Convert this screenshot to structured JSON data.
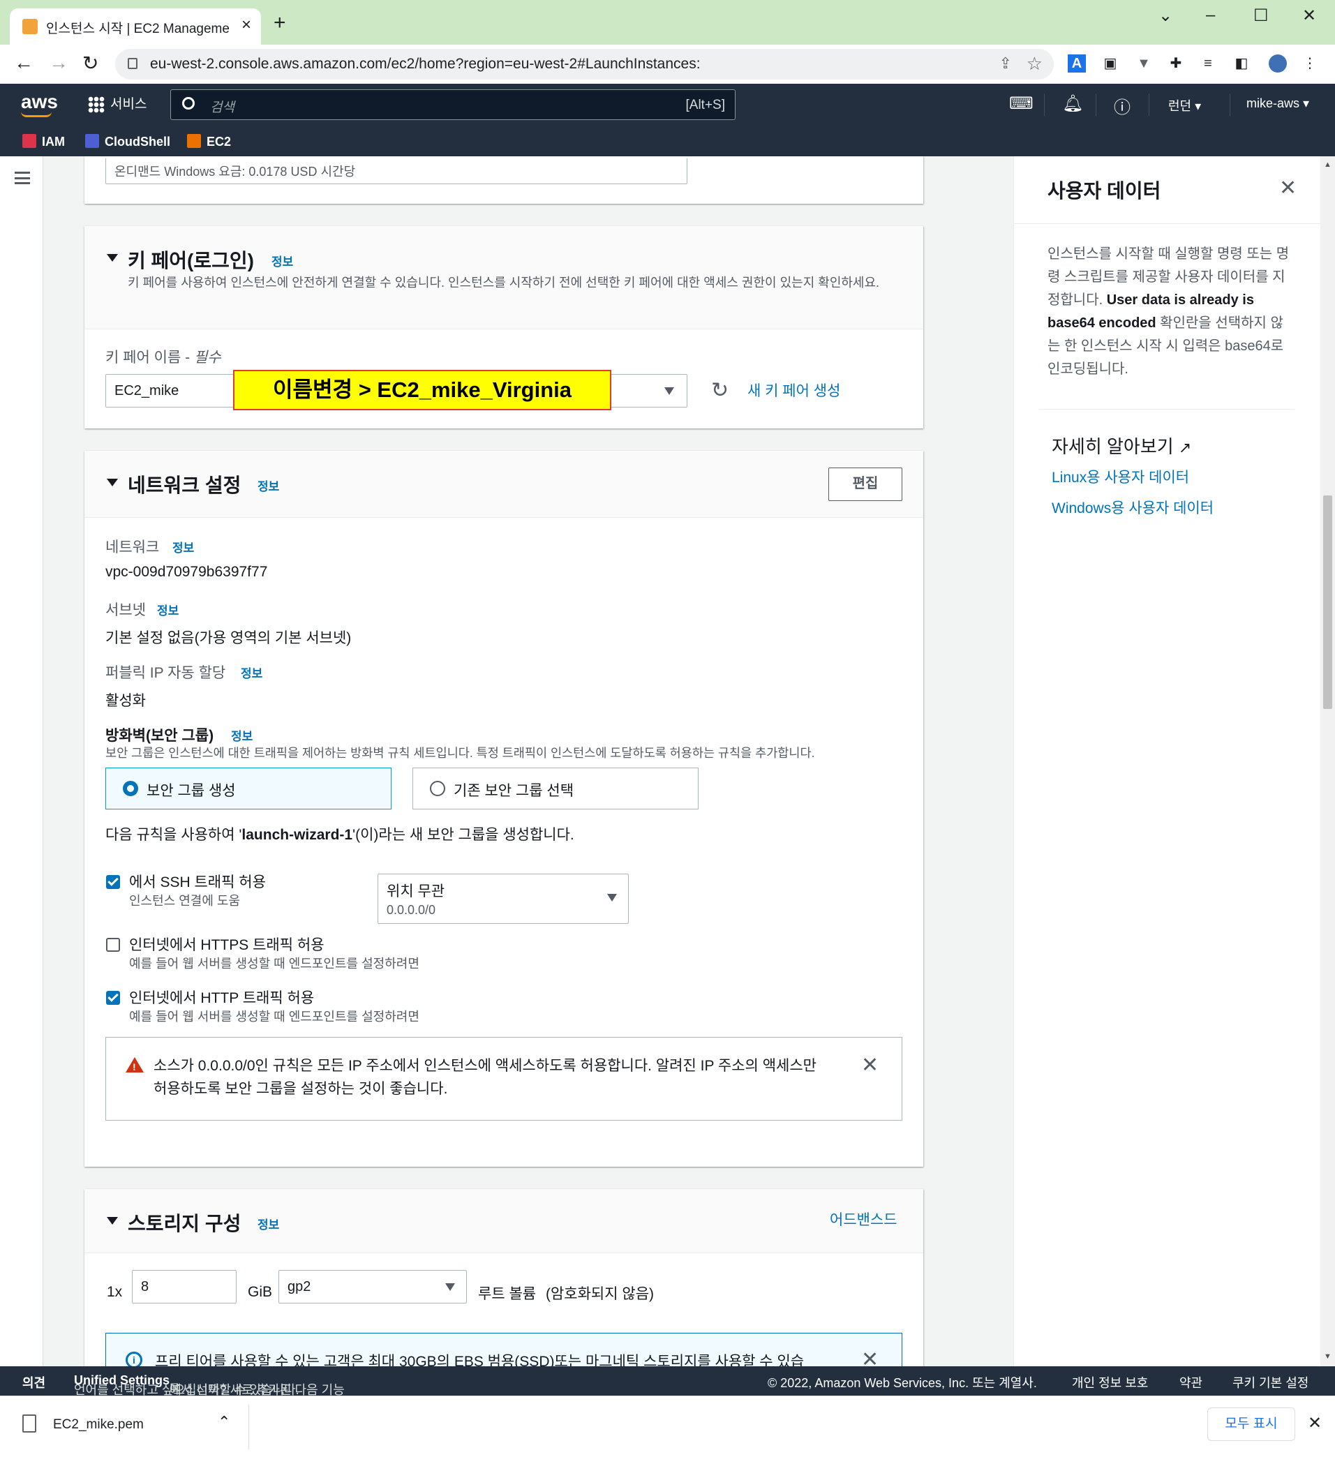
{
  "browser": {
    "tab_title": "인스턴스 시작 | EC2 Manageme",
    "url": "eu-west-2.console.aws.amazon.com/ec2/home?region=eu-west-2#LaunchInstances:"
  },
  "aws_header": {
    "logo": "aws",
    "services_label": "서비스",
    "search_placeholder": "검색",
    "search_shortcut": "[Alt+S]",
    "region": "런던 ▾",
    "account": "mike-aws ▾",
    "favorites": [
      "IAM",
      "CloudShell",
      "EC2"
    ]
  },
  "prev_section": {
    "pricing_text": "온디맨드 Windows 요금: 0.0178 USD 시간당"
  },
  "key_pair": {
    "title": "키 페어(로그인)",
    "info": "정보",
    "description": "키 페어를 사용하여 인스턴스에 안전하게 연결할 수 있습니다. 인스턴스를 시작하기 전에 선택한 키 페어에 대한 액세스 권한이 있는지 확인하세요.",
    "field_label": "키 페어 이름 - ",
    "field_required": "필수",
    "selected_value": "EC2_mike",
    "annotation": "이름변경 > EC2_mike_Virginia",
    "create_link": "새 키 페어 생성"
  },
  "network": {
    "title": "네트워크 설정",
    "info": "정보",
    "edit_button": "편집",
    "network_label": "네트워크",
    "network_value": "vpc-009d70979b6397f77",
    "subnet_label": "서브넷",
    "subnet_value": "기본 설정 없음(가용 영역의 기본 서브넷)",
    "public_ip_label": "퍼블릭 IP 자동 할당",
    "public_ip_value": "활성화",
    "firewall_label": "방화벽(보안 그룹)",
    "firewall_desc": "보안 그룹은 인스턴스에 대한 트래픽을 제어하는 방화벽 규칙 세트입니다. 특정 트래픽이 인스턴스에 도달하도록 허용하는 규칙을 추가합니다.",
    "option_create": "보안 그룹 생성",
    "option_existing": "기존 보안 그룹 선택",
    "rule_sentence_pre": "다음 규칙을 사용하여 '",
    "rule_sentence_name": "launch-wizard-1",
    "rule_sentence_post": "'(이)라는 새 보안 그룹을 생성합니다.",
    "ssh_label": "에서 SSH 트래픽 허용",
    "ssh_help": "인스턴스 연결에 도움",
    "ssh_source_label": "위치 무관",
    "ssh_source_cidr": "0.0.0.0/0",
    "https_label": "인터넷에서 HTTPS 트래픽 허용",
    "https_help": "예를 들어 웹 서버를 생성할 때 엔드포인트를 설정하려면",
    "http_label": "인터넷에서 HTTP 트래픽 허용",
    "http_help": "예를 들어 웹 서버를 생성할 때 엔드포인트를 설정하려면",
    "ssh_checked": true,
    "https_checked": false,
    "http_checked": true,
    "warning": "소스가 0.0.0.0/0인 규칙은 모든 IP 주소에서 인스턴스에 액세스하도록 허용합니다. 알려진 IP 주소의 액세스만 허용하도록 보안 그룹을 설정하는 것이 좋습니다."
  },
  "storage": {
    "title": "스토리지 구성",
    "info": "정보",
    "advanced_link": "어드밴스드",
    "count": "1x",
    "size": "8",
    "unit": "GiB",
    "volume_type": "gp2",
    "root_label": "루트 볼륨",
    "root_note": "(암호화되지 않음)",
    "free_tier_note": "프리 티어를 사용할 수 있는 고객은 최대 30GB의 EBS 범용(SSD)또는 마그네틱 스토리지를 사용할 수 있습"
  },
  "help_panel": {
    "title": "사용자 데이터",
    "body_pre": "인스턴스를 시작할 때 실행할 명령 또는 명령 스크립트를 제공할 사용자 데이터를 지정합니다. ",
    "body_bold": "User data is already is base64 encoded",
    "body_post": " 확인란을 선택하지 않는 한 인스턴스 시작 시 입력은 base64로 인코딩됩니다.",
    "learn_more": "자세히 알아보기",
    "links": [
      "Linux용 사용자 데이터",
      "Windows용 사용자 데이터"
    ]
  },
  "footer": {
    "feedback": "의견",
    "language_pre": "언어를 선택하고 싶으십니까? 새로 추가된 다음 기능",
    "language_link": "Unified Settings",
    "language_post": "에서 선택할 수 있습니다.",
    "copyright": "© 2022, Amazon Web Services, Inc. 또는 계열사.",
    "privacy": "개인 정보 보호",
    "terms": "약관",
    "cookies": "쿠키 기본 설정"
  },
  "download_bar": {
    "file": "EC2_mike.pem",
    "show_all": "모두 표시"
  },
  "colors": {
    "aws_nav": "#232f3e",
    "link": "#0073bb",
    "annotation_bg": "#ffff00",
    "annotation_border": "#e03c31",
    "warning": "#d13212"
  }
}
